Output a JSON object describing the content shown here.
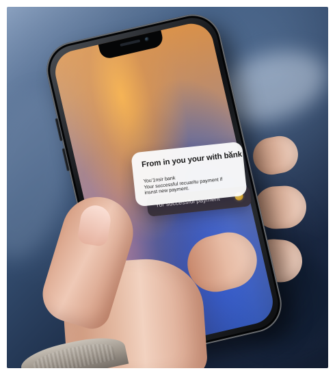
{
  "screen": {
    "notification": {
      "title": "From in you your with bank",
      "body_lines": [
        "You’1nsir bank",
        "Your successful recuaritu payment if",
        "insnst new payment."
      ]
    },
    "payment_banner": {
      "label": "Yor successful payment"
    }
  },
  "icons": {
    "close": "close-icon",
    "coin": "coin-icon",
    "camera": "camera-icon",
    "speaker": "speaker-icon"
  },
  "colors": {
    "notification_card": "#FAFAFA",
    "payment_pill": "#393239",
    "coin": "#F6C033",
    "screen_orange": "#F7B14B",
    "screen_blue": "#3967E8"
  }
}
